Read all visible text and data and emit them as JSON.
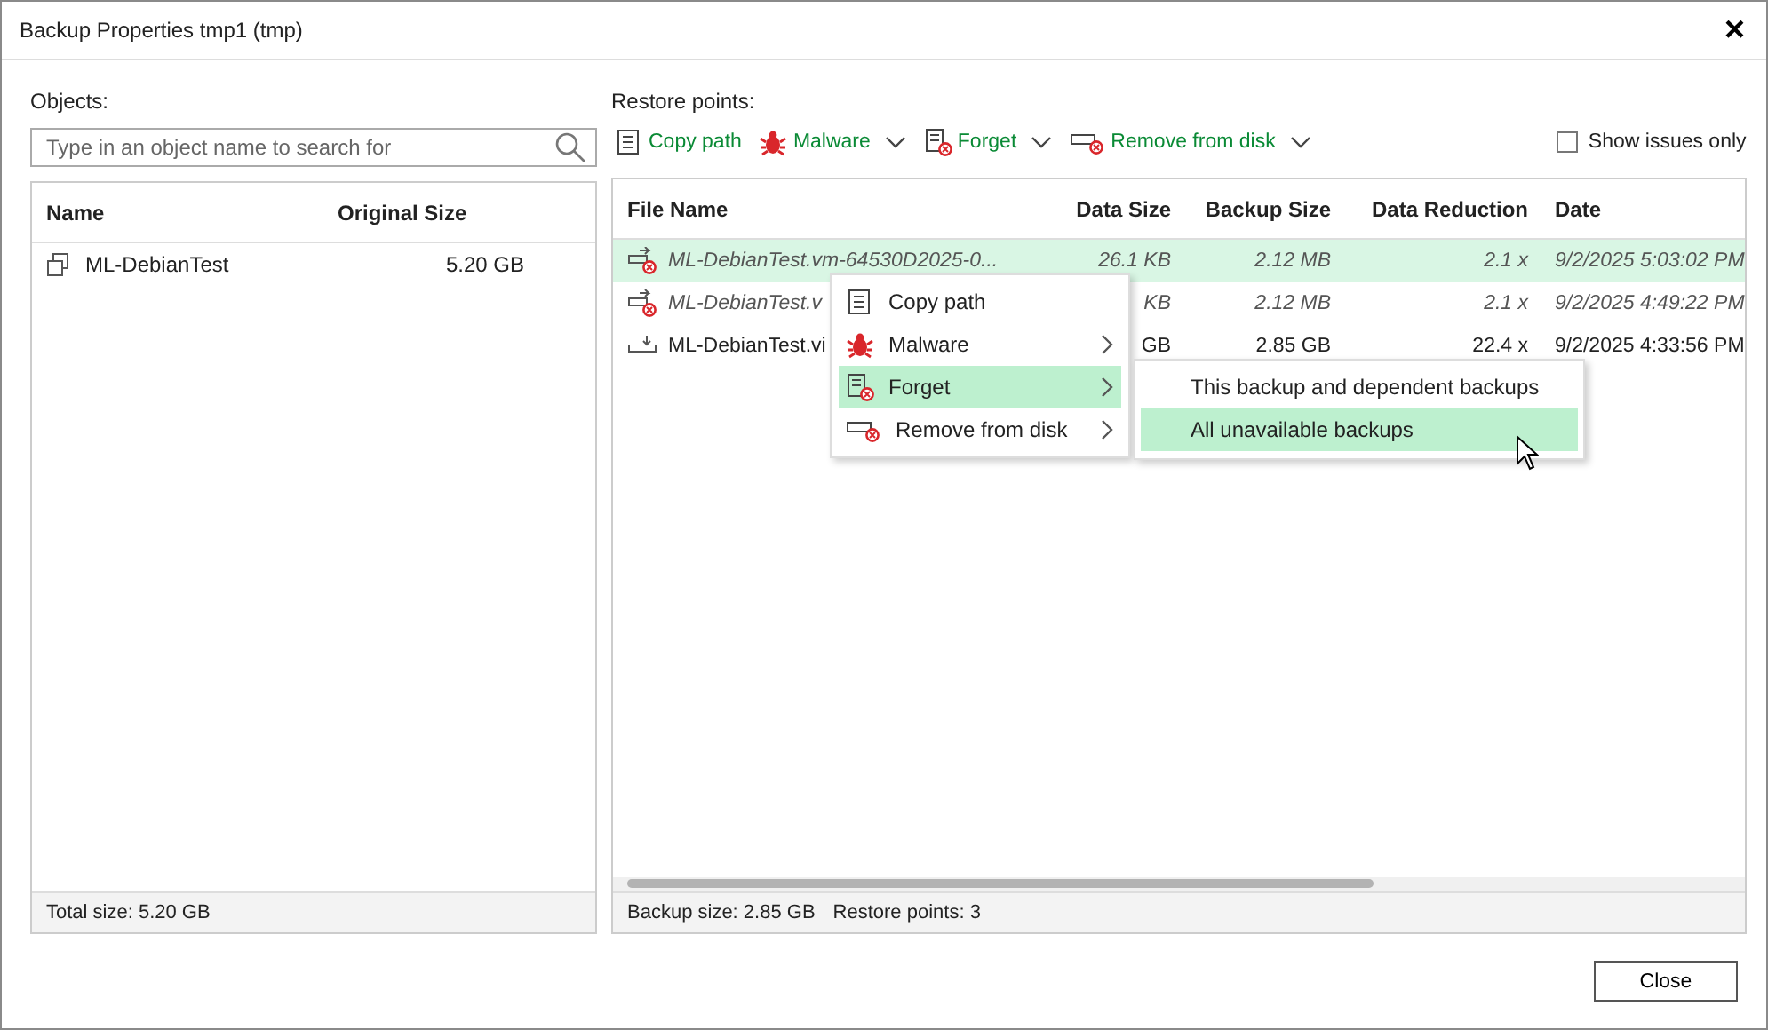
{
  "window": {
    "title": "Backup Properties tmp1 (tmp)",
    "close": "×"
  },
  "objects": {
    "label": "Objects:",
    "search": {
      "placeholder": "Type in an object name to search for"
    },
    "columns": [
      "Name",
      "Original Size"
    ],
    "rows": [
      {
        "name": "ML-DebianTest",
        "size": "5.20 GB"
      }
    ],
    "footer": "Total size: 5.20 GB"
  },
  "restore_points": {
    "label": "Restore points:",
    "toolbar": [
      {
        "kind": "copy",
        "label": "Copy path",
        "dropdown": false
      },
      {
        "kind": "malware",
        "label": "Malware",
        "dropdown": true
      },
      {
        "kind": "forget",
        "label": "Forget",
        "dropdown": true
      },
      {
        "kind": "remove",
        "label": "Remove from disk",
        "dropdown": true
      }
    ],
    "show_issues": {
      "label": "Show issues only",
      "checked": false
    },
    "columns": [
      "File Name",
      "Data Size",
      "Backup Size",
      "Data Reduction",
      "Date"
    ],
    "rows": [
      {
        "name": "ML-DebianTest.vm-64530D2025-0...",
        "data_size": "26.1 KB",
        "backup_size": "2.12 MB",
        "reduction": "2.1 x",
        "date": "9/2/2025 5:03:02 PM",
        "unavailable": true,
        "selected": true
      },
      {
        "name": "ML-DebianTest.v",
        "data_size": "KB",
        "backup_size": "2.12 MB",
        "reduction": "2.1 x",
        "date": "9/2/2025 4:49:22 PM",
        "unavailable": true,
        "selected": false
      },
      {
        "name": "ML-DebianTest.vi",
        "data_size": "GB",
        "backup_size": "2.85 GB",
        "reduction": "22.4 x",
        "date": "9/2/2025 4:33:56 PM",
        "unavailable": false,
        "selected": false
      }
    ],
    "footer": [
      "Backup size: 2.85 GB",
      "Restore points: 3"
    ]
  },
  "context_menu": {
    "items": [
      {
        "kind": "copy",
        "label": "Copy path",
        "submenu": false,
        "selected": false
      },
      {
        "kind": "malware",
        "label": "Malware",
        "submenu": true,
        "selected": false
      },
      {
        "kind": "forget",
        "label": "Forget",
        "submenu": true,
        "selected": true
      },
      {
        "kind": "remove",
        "label": "Remove from disk",
        "submenu": true,
        "selected": false
      }
    ],
    "submenu": [
      {
        "label": "This backup and dependent backups",
        "selected": false
      },
      {
        "label": "All unavailable backups",
        "selected": true
      }
    ]
  },
  "buttons": [
    "Close"
  ]
}
